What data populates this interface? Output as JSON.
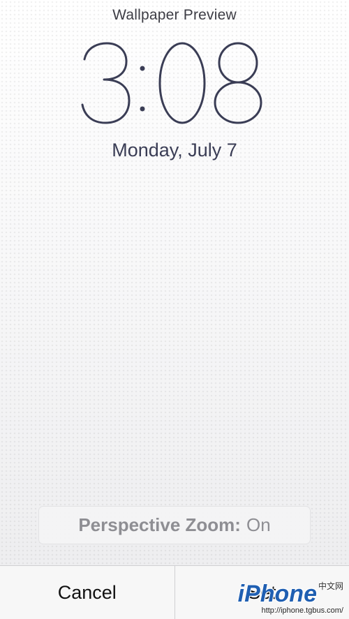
{
  "header": {
    "title": "Wallpaper Preview"
  },
  "lockscreen": {
    "time": "3:08",
    "date": "Monday, July 7"
  },
  "perspective_zoom": {
    "label": "Perspective Zoom:",
    "value": "On"
  },
  "toolbar": {
    "cancel_label": "Cancel",
    "set_label": "Set"
  },
  "watermark": {
    "logo": "iPhone",
    "cn": "中文网",
    "url": "http://iphone.tgbus.com/"
  },
  "colors": {
    "clock": "#3a3d55",
    "pill_text": "#8e8e93",
    "logo": "#1f5fb2"
  }
}
